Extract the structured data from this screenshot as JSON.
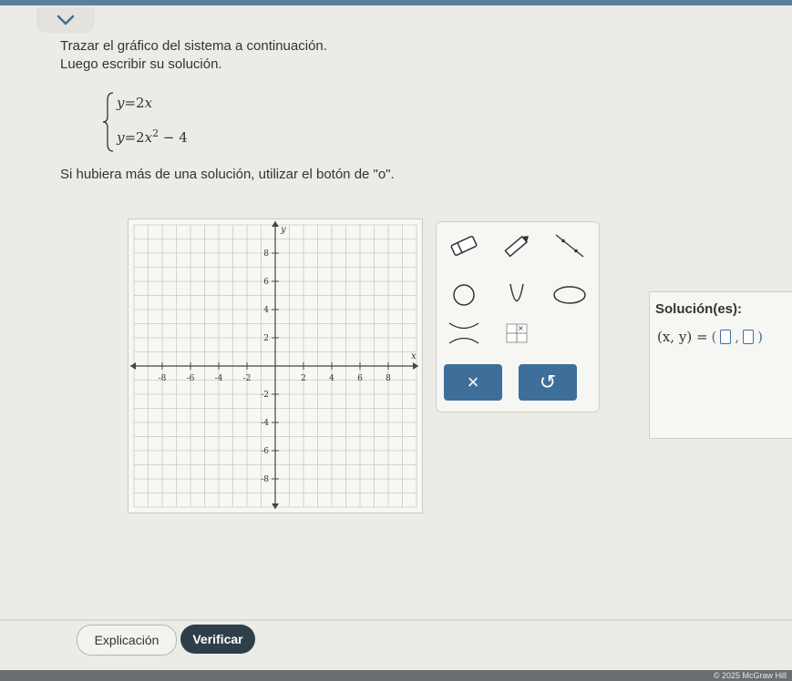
{
  "instructions": {
    "line1": "Trazar el gráfico del sistema a continuación.",
    "line2": "Luego escribir su solución.",
    "note": "Si hubiera más de una solución, utilizar el botón de \"o\"."
  },
  "system": {
    "eq1": {
      "lhs": "y",
      "rhs": "=2",
      "var": "x",
      "tail": ""
    },
    "eq2": {
      "lhs": "y",
      "rhs": "=2",
      "var": "x",
      "exp": "2",
      "tail": "− 4"
    }
  },
  "graph": {
    "x_label": "x",
    "y_label": "y",
    "x_ticks": [
      "-8",
      "-6",
      "-4",
      "-2",
      "2",
      "4",
      "6",
      "8"
    ],
    "y_ticks_pos": [
      "8",
      "6",
      "4",
      "2"
    ],
    "y_ticks_neg": [
      "-2",
      "-4",
      "-6",
      "-8"
    ],
    "range": [
      -10,
      10
    ]
  },
  "tools": {
    "items": [
      "eraser-tool",
      "pencil-tool",
      "line-tool",
      "circle-tool",
      "parabola-tool",
      "ellipse-tool",
      "hyperbola-tool",
      "point-tool"
    ],
    "clear_symbol": "×",
    "undo_symbol": "↺"
  },
  "solution": {
    "title": "Solución(es):",
    "lhs": "(x, y) =",
    "open": "(",
    "comma": ",",
    "close": ")"
  },
  "buttons": {
    "explanation": "Explicación",
    "verify": "Verificar"
  },
  "footer": {
    "copyright": "© 2025 McGraw Hill"
  },
  "colors": {
    "primary": "#3d6f9a",
    "verify": "#2e3f4a"
  }
}
